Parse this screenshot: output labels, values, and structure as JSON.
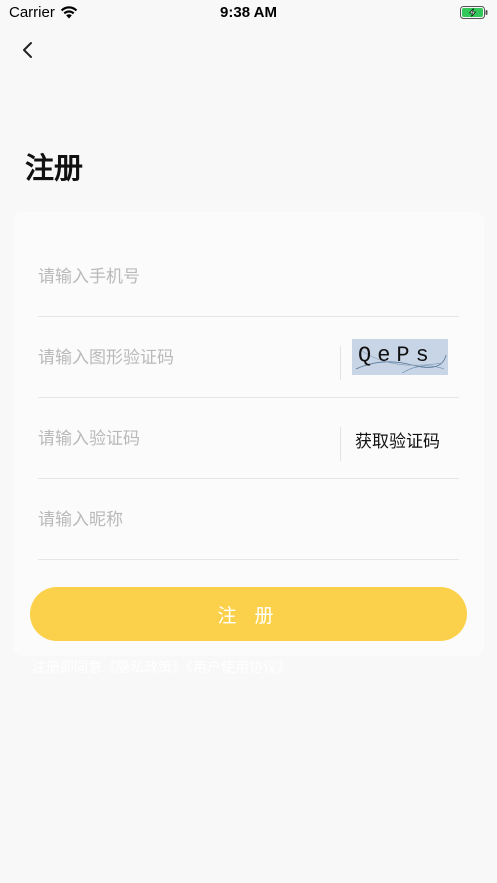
{
  "status_bar": {
    "carrier": "Carrier",
    "time": "9:38 AM",
    "battery_color": "#34c759"
  },
  "header": {
    "title": "注册"
  },
  "form": {
    "phone_placeholder": "请输入手机号",
    "captcha_placeholder": "请输入图形验证码",
    "captcha_text": "QePs",
    "code_placeholder": "请输入验证码",
    "get_code_label": "获取验证码",
    "nickname_placeholder": "请输入昵称"
  },
  "register_button": {
    "label": "注 册",
    "color": "#fbd14b"
  },
  "agreement": {
    "prefix": "注册即同意",
    "link1": "《隐私政策》",
    "link2": "《用户使用协议》"
  }
}
